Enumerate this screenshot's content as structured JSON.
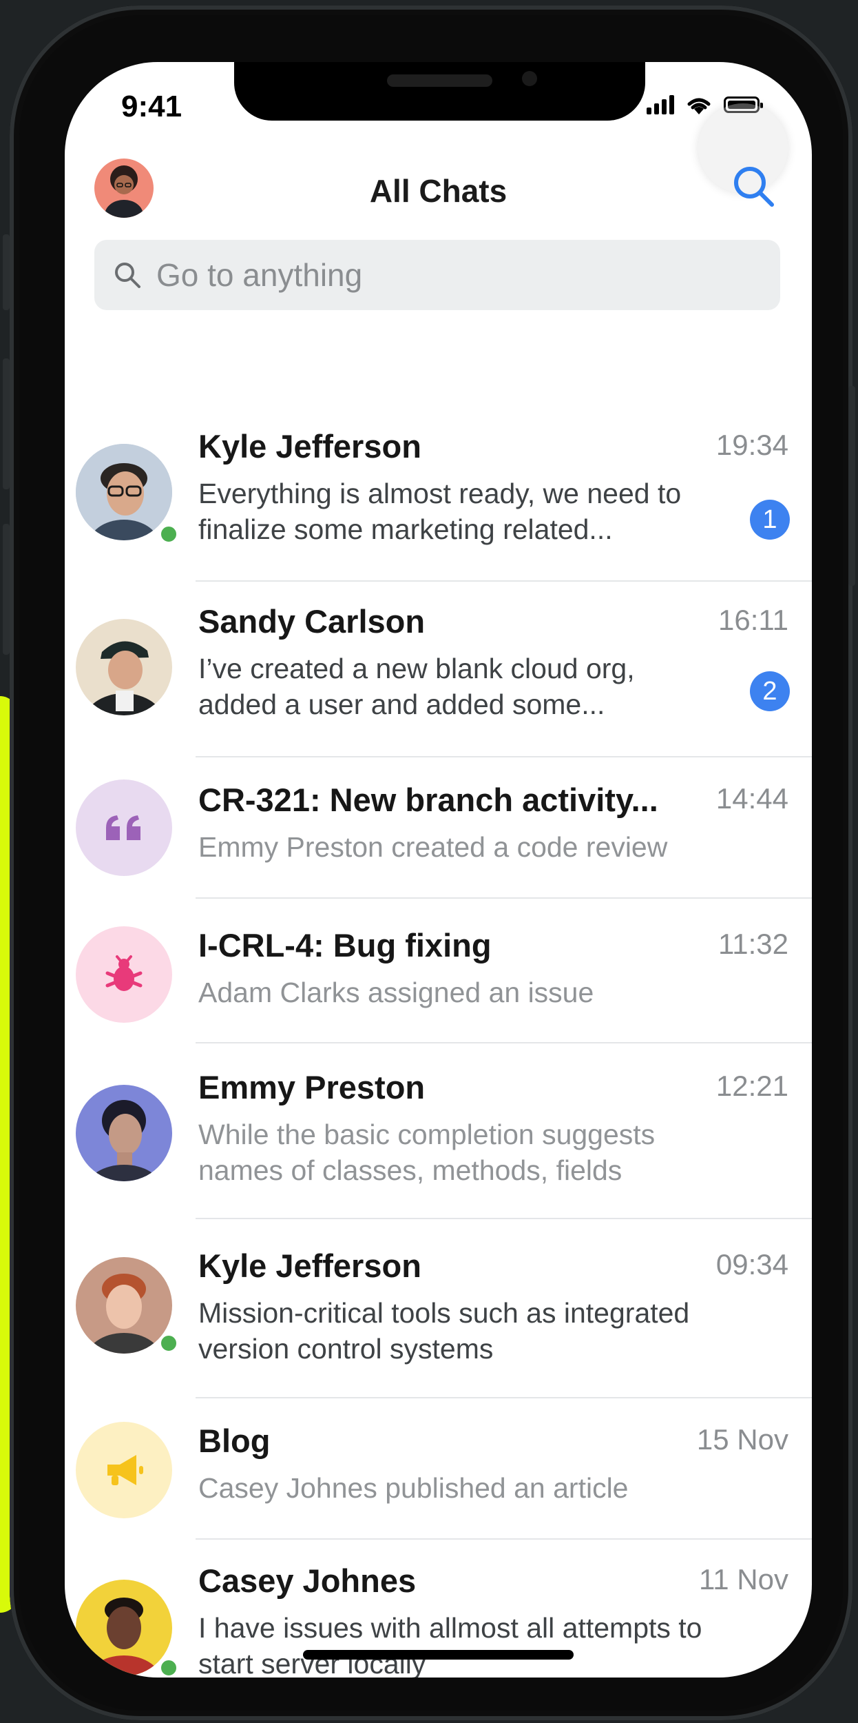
{
  "status_bar": {
    "time": "9:41"
  },
  "header": {
    "title": "All Chats"
  },
  "search": {
    "placeholder": "Go to anything"
  },
  "chats": [
    {
      "title": "Kyle Jefferson",
      "time": "19:34",
      "preview": "Everything is almost ready, we need to finalize some marketing related...",
      "badge": "1",
      "online": true,
      "avatar": "person",
      "unread": true
    },
    {
      "title": "Sandy Carlson",
      "time": "16:11",
      "preview": "I’ve created a new blank cloud org, added a user and added some...",
      "badge": "2",
      "online": false,
      "avatar": "person",
      "unread": true
    },
    {
      "title": "CR-321: New branch activity...",
      "time": "14:44",
      "preview": "Emmy Preston created a code review",
      "avatar": "quote-icon",
      "avatar_color": "#e8daf0",
      "icon_color": "#9c62b8"
    },
    {
      "title": "I-CRL-4: Bug fixing",
      "time": "11:32",
      "preview": "Adam Clarks assigned an issue",
      "avatar": "bug-icon",
      "avatar_color": "#fcd9e6",
      "icon_color": "#e83a7a"
    },
    {
      "title": "Emmy Preston",
      "time": "12:21",
      "preview": "While the basic completion suggests names of classes, methods, fields",
      "online": false,
      "avatar": "person"
    },
    {
      "title": "Kyle Jefferson",
      "time": "09:34",
      "preview": "Mission-critical tools such as integrated version control systems",
      "online": true,
      "avatar": "person"
    },
    {
      "title": "Blog",
      "time": "15 Nov",
      "preview": "Casey Johnes published an article",
      "avatar": "megaphone-icon",
      "avatar_color": "#fdf0c2",
      "icon_color": "#f6c31c"
    },
    {
      "title": "Casey Johnes",
      "time": "11 Nov",
      "preview": "I have issues with allmost all attempts to start server locally",
      "online": true,
      "avatar": "person"
    }
  ],
  "colors": {
    "accent": "#3d82f0",
    "online": "#4caf50",
    "brand_bar": "#d8fa0a"
  }
}
